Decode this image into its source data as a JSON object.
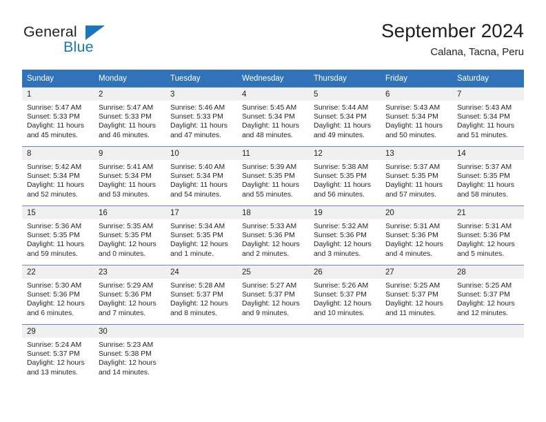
{
  "brand": {
    "name_top": "General",
    "name_bottom": "Blue",
    "triangle_color": "#1b75bb"
  },
  "header": {
    "title": "September 2024",
    "subtitle": "Calana, Tacna, Peru"
  },
  "theme": {
    "header_blue": "#3173b8",
    "row_rule": "#5c8cbd",
    "daynum_bg": "#f0f0f0",
    "text": "#231f20"
  },
  "calendar": {
    "weekday_headers": [
      "Sunday",
      "Monday",
      "Tuesday",
      "Wednesday",
      "Thursday",
      "Friday",
      "Saturday"
    ],
    "weeks": [
      [
        {
          "day": "1",
          "sunrise": "Sunrise: 5:47 AM",
          "sunset": "Sunset: 5:33 PM",
          "daylight": "Daylight: 11 hours and 45 minutes."
        },
        {
          "day": "2",
          "sunrise": "Sunrise: 5:47 AM",
          "sunset": "Sunset: 5:33 PM",
          "daylight": "Daylight: 11 hours and 46 minutes."
        },
        {
          "day": "3",
          "sunrise": "Sunrise: 5:46 AM",
          "sunset": "Sunset: 5:33 PM",
          "daylight": "Daylight: 11 hours and 47 minutes."
        },
        {
          "day": "4",
          "sunrise": "Sunrise: 5:45 AM",
          "sunset": "Sunset: 5:34 PM",
          "daylight": "Daylight: 11 hours and 48 minutes."
        },
        {
          "day": "5",
          "sunrise": "Sunrise: 5:44 AM",
          "sunset": "Sunset: 5:34 PM",
          "daylight": "Daylight: 11 hours and 49 minutes."
        },
        {
          "day": "6",
          "sunrise": "Sunrise: 5:43 AM",
          "sunset": "Sunset: 5:34 PM",
          "daylight": "Daylight: 11 hours and 50 minutes."
        },
        {
          "day": "7",
          "sunrise": "Sunrise: 5:43 AM",
          "sunset": "Sunset: 5:34 PM",
          "daylight": "Daylight: 11 hours and 51 minutes."
        }
      ],
      [
        {
          "day": "8",
          "sunrise": "Sunrise: 5:42 AM",
          "sunset": "Sunset: 5:34 PM",
          "daylight": "Daylight: 11 hours and 52 minutes."
        },
        {
          "day": "9",
          "sunrise": "Sunrise: 5:41 AM",
          "sunset": "Sunset: 5:34 PM",
          "daylight": "Daylight: 11 hours and 53 minutes."
        },
        {
          "day": "10",
          "sunrise": "Sunrise: 5:40 AM",
          "sunset": "Sunset: 5:34 PM",
          "daylight": "Daylight: 11 hours and 54 minutes."
        },
        {
          "day": "11",
          "sunrise": "Sunrise: 5:39 AM",
          "sunset": "Sunset: 5:35 PM",
          "daylight": "Daylight: 11 hours and 55 minutes."
        },
        {
          "day": "12",
          "sunrise": "Sunrise: 5:38 AM",
          "sunset": "Sunset: 5:35 PM",
          "daylight": "Daylight: 11 hours and 56 minutes."
        },
        {
          "day": "13",
          "sunrise": "Sunrise: 5:37 AM",
          "sunset": "Sunset: 5:35 PM",
          "daylight": "Daylight: 11 hours and 57 minutes."
        },
        {
          "day": "14",
          "sunrise": "Sunrise: 5:37 AM",
          "sunset": "Sunset: 5:35 PM",
          "daylight": "Daylight: 11 hours and 58 minutes."
        }
      ],
      [
        {
          "day": "15",
          "sunrise": "Sunrise: 5:36 AM",
          "sunset": "Sunset: 5:35 PM",
          "daylight": "Daylight: 11 hours and 59 minutes."
        },
        {
          "day": "16",
          "sunrise": "Sunrise: 5:35 AM",
          "sunset": "Sunset: 5:35 PM",
          "daylight": "Daylight: 12 hours and 0 minutes."
        },
        {
          "day": "17",
          "sunrise": "Sunrise: 5:34 AM",
          "sunset": "Sunset: 5:35 PM",
          "daylight": "Daylight: 12 hours and 1 minute."
        },
        {
          "day": "18",
          "sunrise": "Sunrise: 5:33 AM",
          "sunset": "Sunset: 5:36 PM",
          "daylight": "Daylight: 12 hours and 2 minutes."
        },
        {
          "day": "19",
          "sunrise": "Sunrise: 5:32 AM",
          "sunset": "Sunset: 5:36 PM",
          "daylight": "Daylight: 12 hours and 3 minutes."
        },
        {
          "day": "20",
          "sunrise": "Sunrise: 5:31 AM",
          "sunset": "Sunset: 5:36 PM",
          "daylight": "Daylight: 12 hours and 4 minutes."
        },
        {
          "day": "21",
          "sunrise": "Sunrise: 5:31 AM",
          "sunset": "Sunset: 5:36 PM",
          "daylight": "Daylight: 12 hours and 5 minutes."
        }
      ],
      [
        {
          "day": "22",
          "sunrise": "Sunrise: 5:30 AM",
          "sunset": "Sunset: 5:36 PM",
          "daylight": "Daylight: 12 hours and 6 minutes."
        },
        {
          "day": "23",
          "sunrise": "Sunrise: 5:29 AM",
          "sunset": "Sunset: 5:36 PM",
          "daylight": "Daylight: 12 hours and 7 minutes."
        },
        {
          "day": "24",
          "sunrise": "Sunrise: 5:28 AM",
          "sunset": "Sunset: 5:37 PM",
          "daylight": "Daylight: 12 hours and 8 minutes."
        },
        {
          "day": "25",
          "sunrise": "Sunrise: 5:27 AM",
          "sunset": "Sunset: 5:37 PM",
          "daylight": "Daylight: 12 hours and 9 minutes."
        },
        {
          "day": "26",
          "sunrise": "Sunrise: 5:26 AM",
          "sunset": "Sunset: 5:37 PM",
          "daylight": "Daylight: 12 hours and 10 minutes."
        },
        {
          "day": "27",
          "sunrise": "Sunrise: 5:25 AM",
          "sunset": "Sunset: 5:37 PM",
          "daylight": "Daylight: 12 hours and 11 minutes."
        },
        {
          "day": "28",
          "sunrise": "Sunrise: 5:25 AM",
          "sunset": "Sunset: 5:37 PM",
          "daylight": "Daylight: 12 hours and 12 minutes."
        }
      ],
      [
        {
          "day": "29",
          "sunrise": "Sunrise: 5:24 AM",
          "sunset": "Sunset: 5:37 PM",
          "daylight": "Daylight: 12 hours and 13 minutes."
        },
        {
          "day": "30",
          "sunrise": "Sunrise: 5:23 AM",
          "sunset": "Sunset: 5:38 PM",
          "daylight": "Daylight: 12 hours and 14 minutes."
        },
        {
          "day": "",
          "sunrise": "",
          "sunset": "",
          "daylight": ""
        },
        {
          "day": "",
          "sunrise": "",
          "sunset": "",
          "daylight": ""
        },
        {
          "day": "",
          "sunrise": "",
          "sunset": "",
          "daylight": ""
        },
        {
          "day": "",
          "sunrise": "",
          "sunset": "",
          "daylight": ""
        },
        {
          "day": "",
          "sunrise": "",
          "sunset": "",
          "daylight": ""
        }
      ]
    ]
  }
}
